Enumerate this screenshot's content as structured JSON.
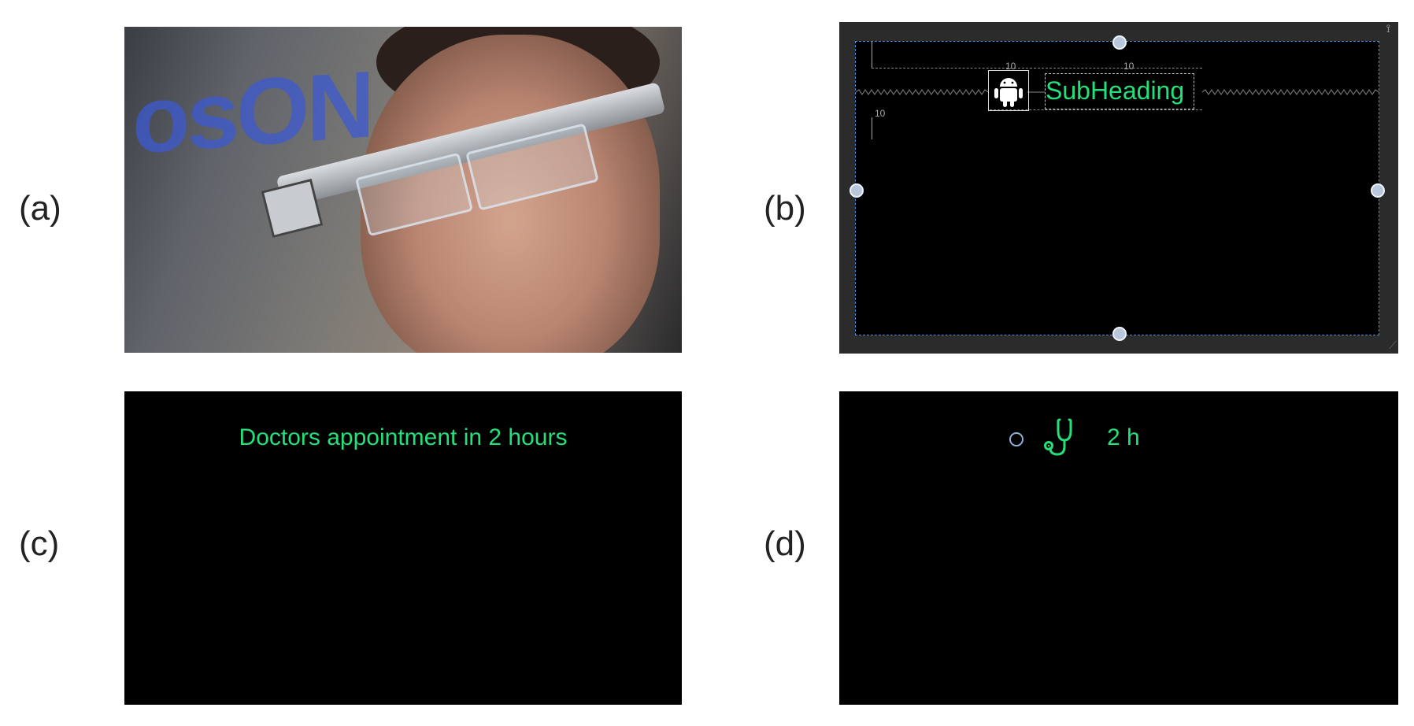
{
  "labels": {
    "a": "(a)",
    "b": "(b)",
    "c": "(c)",
    "d": "(d)"
  },
  "panel_a": {
    "brand_watermark": "osON"
  },
  "panel_b": {
    "subheading": "SubHeading",
    "margin_values": [
      "10",
      "10",
      "10"
    ],
    "accent_color": "#23e07a"
  },
  "panel_c": {
    "notification": "Doctors appointment in 2 hours"
  },
  "panel_d": {
    "icon": "stethoscope-icon",
    "time": "2 h"
  },
  "colors": {
    "text_green": "#23e07a",
    "background": "#000000"
  }
}
